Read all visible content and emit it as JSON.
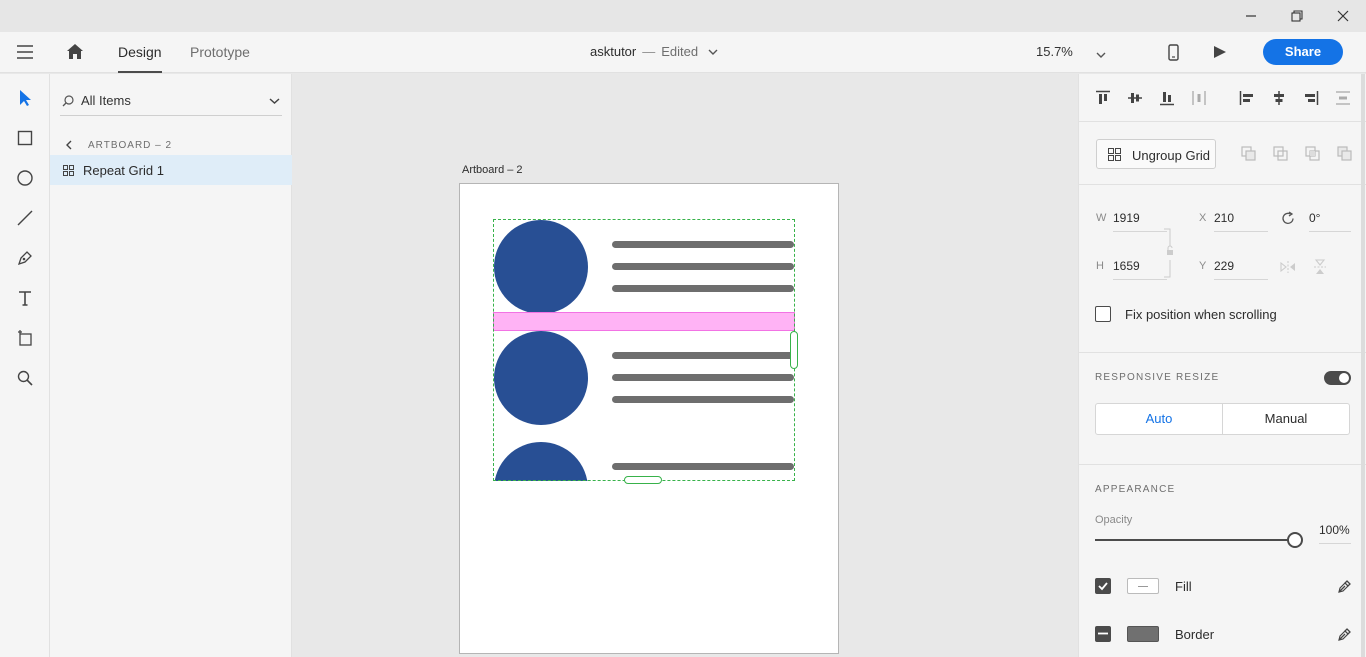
{
  "header": {
    "tabs": [
      {
        "label": "Design"
      },
      {
        "label": "Prototype"
      }
    ],
    "document_name": "asktutor",
    "separator": "—",
    "document_status": "Edited",
    "zoom": "15.7%",
    "share_label": "Share"
  },
  "layers": {
    "filter_label": "All Items",
    "breadcrumb": "ARTBOARD – 2",
    "items": [
      {
        "label": "Repeat Grid 1"
      }
    ]
  },
  "canvas": {
    "artboard_label": "Artboard – 2"
  },
  "inspector": {
    "ungroup_label": "Ungroup Grid",
    "width_label": "W",
    "width_value": "1919",
    "height_label": "H",
    "height_value": "1659",
    "x_label": "X",
    "x_value": "210",
    "y_label": "Y",
    "y_value": "229",
    "rotation_value": "0°",
    "fix_position_label": "Fix position when scrolling",
    "responsive_resize_title": "RESPONSIVE RESIZE",
    "resize_options": [
      "Auto",
      "Manual"
    ],
    "appearance_title": "APPEARANCE",
    "opacity_label": "Opacity",
    "opacity_value": "100%",
    "opacity_fraction": 1.0,
    "fill_label": "Fill",
    "border_label": "Border"
  },
  "colors": {
    "accent": "#1473e6",
    "circle": "#284f94",
    "gutter": "#ffb3f5",
    "selection": "#38b24a"
  }
}
